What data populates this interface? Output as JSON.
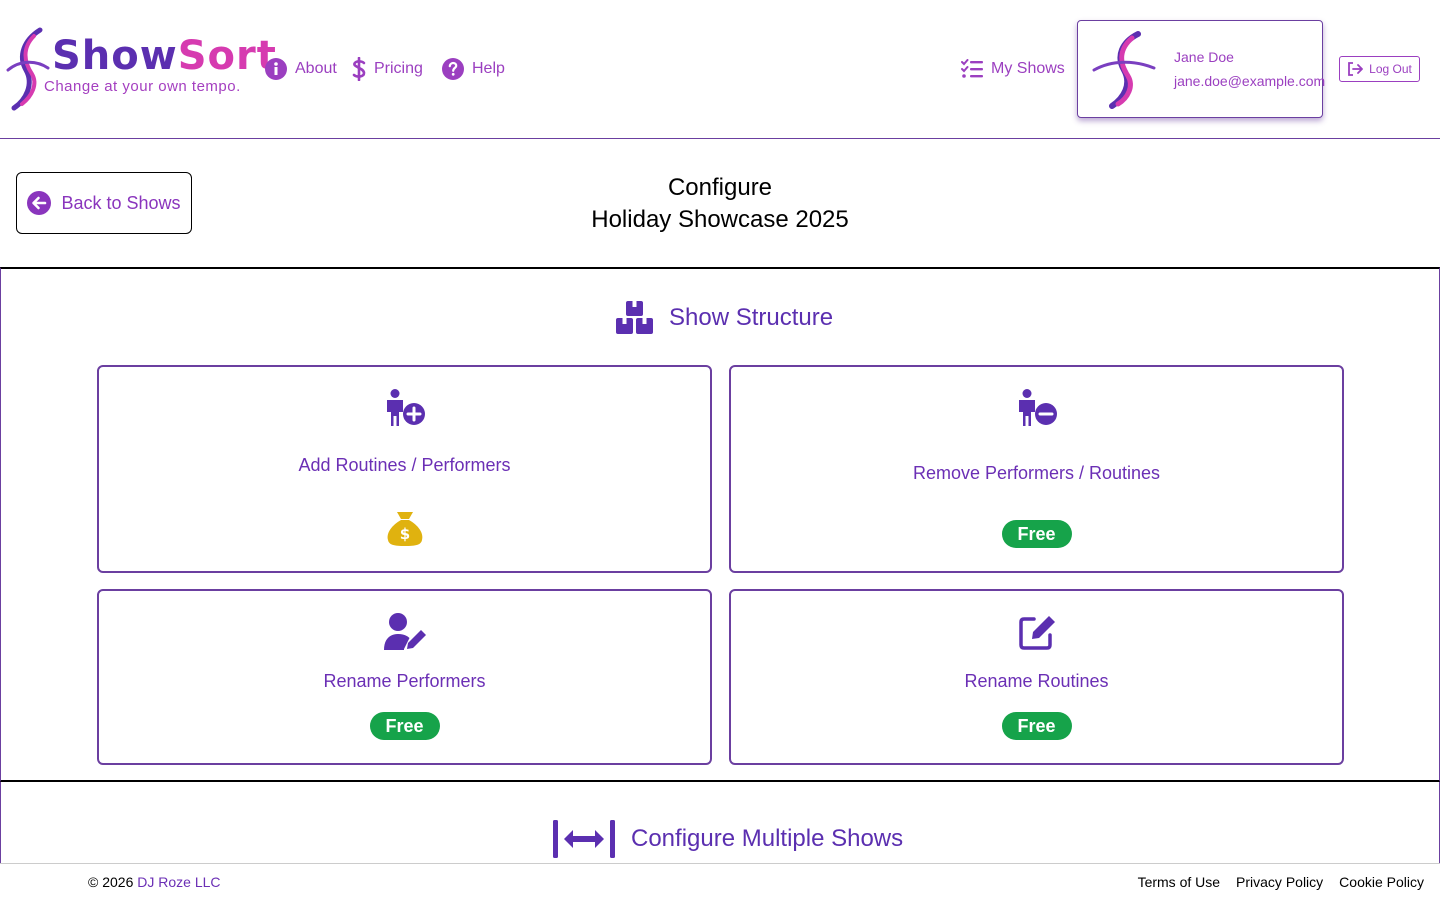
{
  "brand": {
    "name_part1": "Show",
    "name_part2": "Sort",
    "tagline": "Change at your own tempo."
  },
  "nav": {
    "about": "About",
    "pricing": "Pricing",
    "help": "Help",
    "my_shows": "My Shows"
  },
  "user": {
    "name": "Jane Doe",
    "email": "jane.doe@example.com",
    "logout": "Log Out"
  },
  "page": {
    "back_label": "Back to Shows",
    "title_line1": "Configure",
    "title_line2": "Holiday Showcase 2025"
  },
  "structure": {
    "heading": "Show Structure",
    "cards": [
      {
        "label": "Add Routines / Performers",
        "icon": "person-add-icon",
        "badge": null,
        "paid_icon": "money-bag-icon"
      },
      {
        "label": "Remove Performers / Routines",
        "icon": "person-remove-icon",
        "badge": "Free"
      },
      {
        "label": "Rename Performers",
        "icon": "user-pen-icon",
        "badge": "Free"
      },
      {
        "label": "Rename Routines",
        "icon": "edit-icon",
        "badge": "Free"
      }
    ]
  },
  "multiple": {
    "heading": "Configure Multiple Shows"
  },
  "footer": {
    "copyright": "© 2026",
    "company": "DJ Roze LLC",
    "terms": "Terms of Use",
    "privacy": "Privacy Policy",
    "cookie": "Cookie Policy"
  },
  "colors": {
    "primary_purple": "#5b2fb0",
    "link_purple": "#9b3fc0",
    "magenta": "#d63bb0",
    "free_green": "#16a34a",
    "money_gold": "#e0b20f"
  }
}
